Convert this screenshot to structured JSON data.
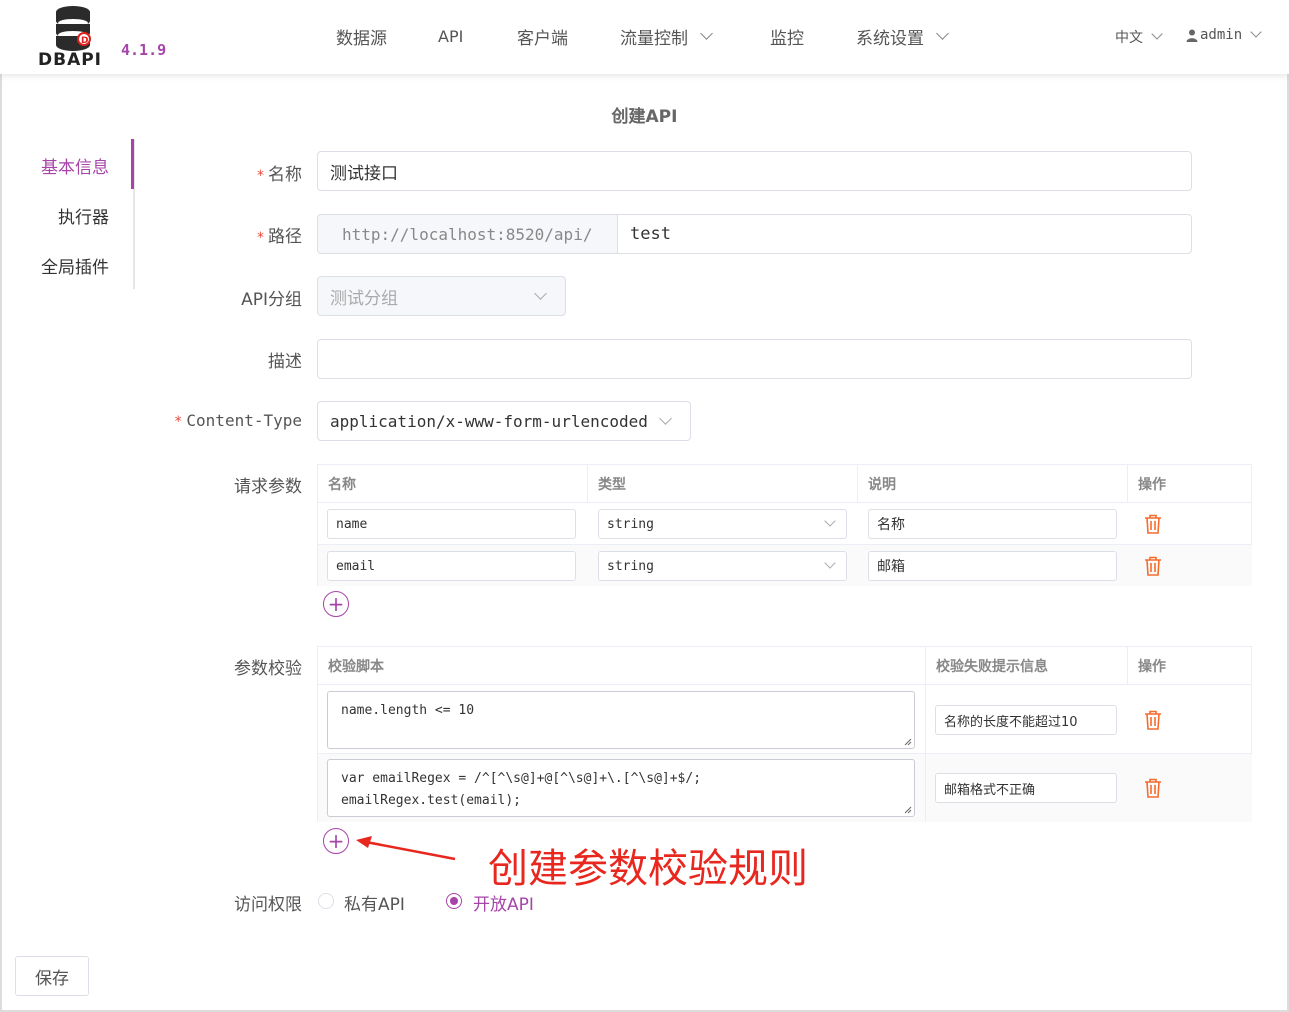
{
  "header": {
    "logo_text": "DBAPI",
    "version": "4.1.9",
    "nav": [
      {
        "label": "数据源",
        "has_dropdown": false
      },
      {
        "label": "API",
        "has_dropdown": false
      },
      {
        "label": "客户端",
        "has_dropdown": false
      },
      {
        "label": "流量控制",
        "has_dropdown": true
      },
      {
        "label": "监控",
        "has_dropdown": false
      },
      {
        "label": "系统设置",
        "has_dropdown": true
      }
    ],
    "language": "中文",
    "user": "admin"
  },
  "page_title": "创建API",
  "side_menu": {
    "items": [
      {
        "label": "基本信息",
        "active": true
      },
      {
        "label": "执行器",
        "active": false
      },
      {
        "label": "全局插件",
        "active": false
      }
    ]
  },
  "form": {
    "name": {
      "label": "名称",
      "value": "测试接口"
    },
    "path": {
      "label": "路径",
      "prefix": "http://localhost:8520/api/",
      "value": "test"
    },
    "group": {
      "label": "API分组",
      "value": "测试分组"
    },
    "desc": {
      "label": "描述",
      "value": ""
    },
    "content_type": {
      "label": "Content-Type",
      "value": "application/x-www-form-urlencoded"
    },
    "params": {
      "label": "请求参数",
      "headers": [
        "名称",
        "类型",
        "说明",
        "操作"
      ],
      "rows": [
        {
          "name": "name",
          "type": "string",
          "desc": "名称"
        },
        {
          "name": "email",
          "type": "string",
          "desc": "邮箱"
        }
      ]
    },
    "validation": {
      "label": "参数校验",
      "headers": [
        "校验脚本",
        "校验失败提示信息",
        "操作"
      ],
      "rows": [
        {
          "script": "name.length <= 10",
          "message": "名称的长度不能超过10"
        },
        {
          "script": "var emailRegex = /^[^\\s@]+@[^\\s@]+\\.[^\\s@]+$/;\nemailRegex.test(email);",
          "message": "邮箱格式不正确"
        }
      ]
    },
    "access": {
      "label": "访问权限",
      "options": [
        {
          "label": "私有API",
          "selected": false
        },
        {
          "label": "开放API",
          "selected": true
        }
      ]
    }
  },
  "annotation": "创建参数校验规则",
  "save_label": "保存",
  "colors": {
    "accent": "#a644a8",
    "required": "#e74c3c",
    "danger": "#e8271f",
    "trash": "#f56c2d"
  },
  "icons": [
    "database-logo-icon",
    "chevron-down-icon",
    "user-icon",
    "trash-icon",
    "add-circle-icon",
    "red-arrow-icon"
  ]
}
